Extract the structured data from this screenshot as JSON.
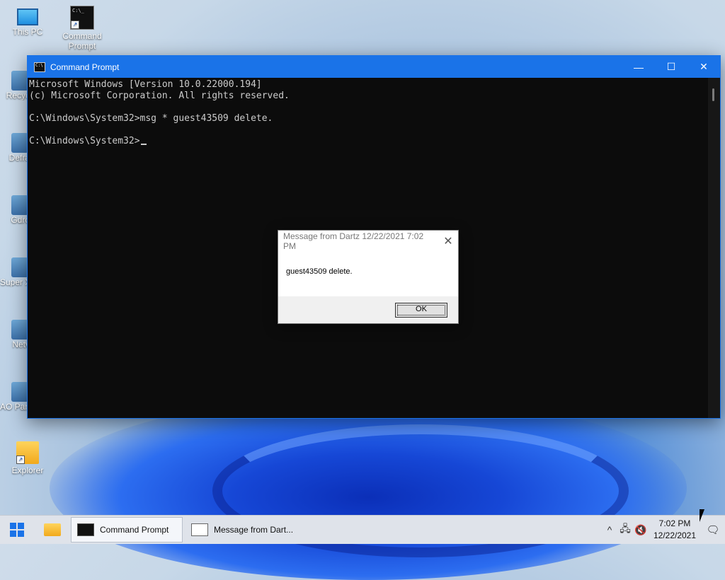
{
  "desktop": {
    "icons": [
      {
        "label": "This PC"
      },
      {
        "label": "Command Prompt"
      }
    ],
    "partial_icons": [
      {
        "label": "Recyc"
      },
      {
        "label": "Defra"
      },
      {
        "label": "Gdro"
      },
      {
        "label": "Super X"
      },
      {
        "label": "Netv"
      },
      {
        "label": "AO Partition A..."
      },
      {
        "label": "Explorer"
      }
    ]
  },
  "cmd_window": {
    "title": "Command Prompt",
    "buttons": {
      "minimize": "—",
      "maximize": "☐",
      "close": "✕"
    },
    "lines": [
      "Microsoft Windows [Version 10.0.22000.194]",
      "(c) Microsoft Corporation. All rights reserved.",
      "",
      "C:\\Windows\\System32>msg * guest43509 delete.",
      "",
      "C:\\Windows\\System32>"
    ]
  },
  "message_dialog": {
    "title": "Message from Dartz 12/22/2021 7:02 PM",
    "close": "✕",
    "text": "guest43509 delete.",
    "ok_label": "OK"
  },
  "taskbar": {
    "tasks": [
      {
        "label": "Command Prompt"
      },
      {
        "label": "Message from Dart..."
      }
    ],
    "tray": {
      "chevron": "^",
      "time": "7:02 PM",
      "date": "12/22/2021"
    }
  },
  "colors": {
    "accent": "#1a73e8",
    "console_bg": "#0c0c0c",
    "console_text": "#cccccc"
  },
  "icon_names": [
    "monitor-icon",
    "cmd-icon",
    "folder-icon",
    "windows-logo-icon",
    "network-icon",
    "volume-muted-icon",
    "notification-icon"
  ]
}
